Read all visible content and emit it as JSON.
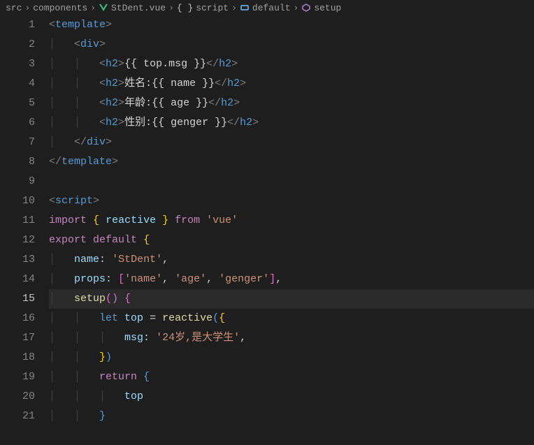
{
  "breadcrumb": {
    "items": [
      "src",
      "components",
      "StDent.vue",
      "script",
      "default",
      "setup"
    ]
  },
  "gutter": {
    "lines": [
      "1",
      "2",
      "3",
      "4",
      "5",
      "6",
      "7",
      "8",
      "9",
      "10",
      "11",
      "12",
      "13",
      "14",
      "15",
      "16",
      "17",
      "18",
      "19",
      "20",
      "21"
    ],
    "activeLine": 15
  },
  "code": {
    "l1": {
      "open": "<",
      "tag": "template",
      "close": ">"
    },
    "l2": {
      "open": "<",
      "tag": "div",
      "close": ">"
    },
    "l3": {
      "open": "<",
      "tag": "h2",
      "close": ">",
      "expr": "{{ top.msg }}",
      "copen": "</",
      "ctag": "h2",
      "cclose": ">"
    },
    "l4": {
      "open": "<",
      "tag": "h2",
      "close": ">",
      "label": "姓名:",
      "expr": "{{ name }}",
      "copen": "</",
      "ctag": "h2",
      "cclose": ">"
    },
    "l5": {
      "open": "<",
      "tag": "h2",
      "close": ">",
      "label": "年龄:",
      "expr": "{{ age }}",
      "copen": "</",
      "ctag": "h2",
      "cclose": ">"
    },
    "l6": {
      "open": "<",
      "tag": "h2",
      "close": ">",
      "label": "性别:",
      "expr": "{{ genger }}",
      "copen": "</",
      "ctag": "h2",
      "cclose": ">"
    },
    "l7": {
      "open": "</",
      "tag": "div",
      "close": ">"
    },
    "l8": {
      "open": "</",
      "tag": "template",
      "close": ">"
    },
    "l10": {
      "open": "<",
      "tag": "script",
      "close": ">"
    },
    "l11": {
      "import": "import",
      "lb": "{",
      "reactive": "reactive",
      "rb": "}",
      "from": "from",
      "vue": "'vue'"
    },
    "l12": {
      "export": "export",
      "default": "default",
      "lb": "{"
    },
    "l13": {
      "name": "name",
      "colon": ":",
      "val": "'StDent'",
      "comma": ","
    },
    "l14": {
      "props": "props",
      "colon": ":",
      "lb": "[",
      "a": "'name'",
      "c1": ",",
      "b": "'age'",
      "c2": ",",
      "c": "'genger'",
      "rb": "]",
      "comma": ","
    },
    "l15": {
      "setup": "setup",
      "paren": "()",
      "lb": "{"
    },
    "l16": {
      "let": "let",
      "top": "top",
      "eq": "=",
      "reactive": "reactive",
      "lp": "(",
      "lb": "{"
    },
    "l17": {
      "msg": "msg",
      "colon": ":",
      "val": "'24岁,是大学生'",
      "comma": ","
    },
    "l18": {
      "rb": "}",
      "rp": ")"
    },
    "l19": {
      "return": "return",
      "lb": "{"
    },
    "l20": {
      "top": "top"
    },
    "l21": {
      "rb": "}"
    }
  }
}
